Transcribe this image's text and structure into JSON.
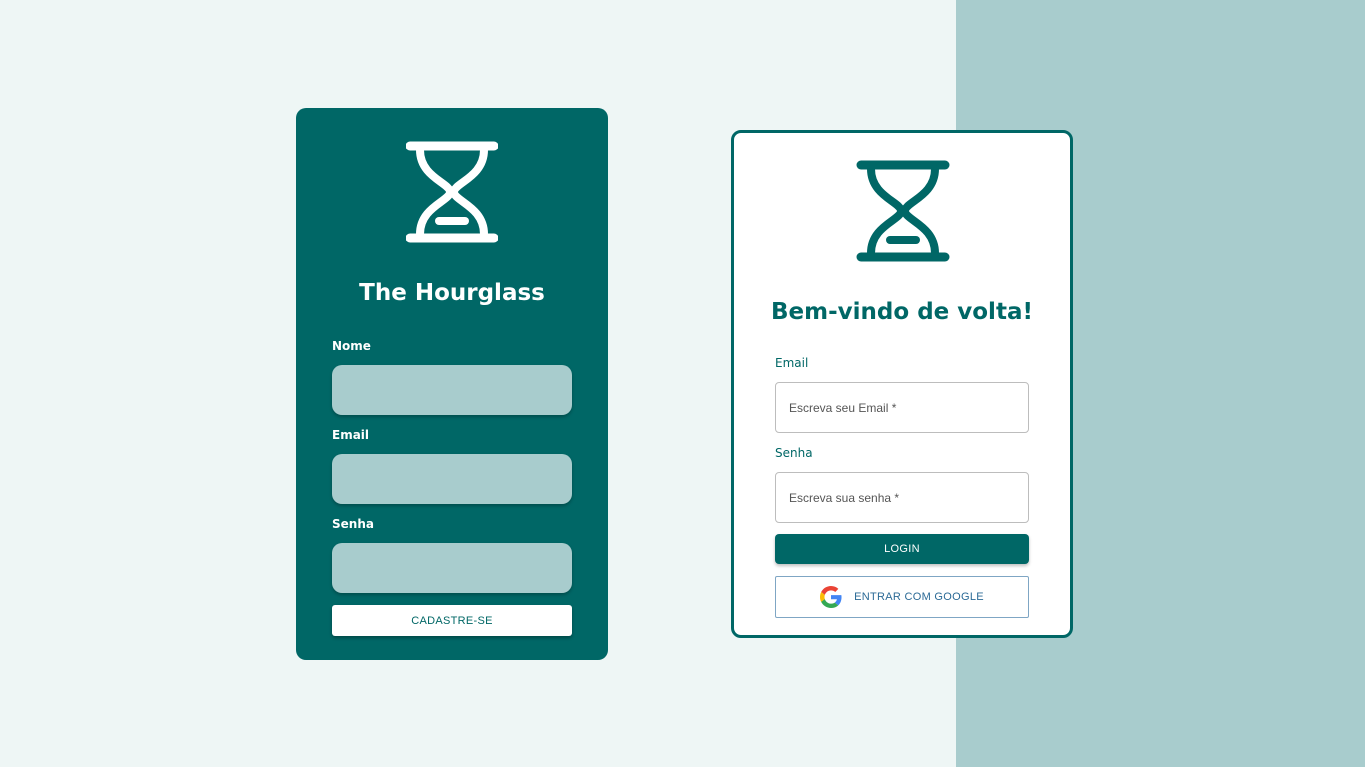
{
  "colors": {
    "primary": "#006766",
    "light": "#a8cccd",
    "page_bg": "#eef6f5"
  },
  "signup": {
    "logo_icon": "hourglass-icon",
    "title": "The Hourglass",
    "name_label": "Nome",
    "email_label": "Email",
    "password_label": "Senha",
    "submit_label": "CADASTRE-SE"
  },
  "login": {
    "logo_icon": "hourglass-icon",
    "title": "Bem-vindo de volta!",
    "email_label": "Email",
    "email_placeholder": "Escreva seu Email *",
    "password_label": "Senha",
    "password_placeholder": "Escreva sua senha *",
    "login_label": "LOGIN",
    "google_label": "ENTRAR COM GOOGLE",
    "google_icon": "google-icon"
  }
}
